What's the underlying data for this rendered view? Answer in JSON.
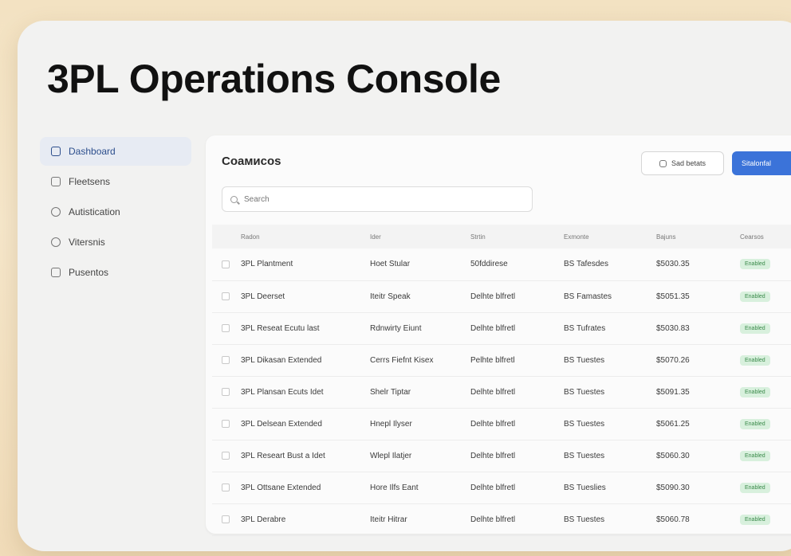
{
  "app": {
    "title": "3PL Operations Console"
  },
  "sidebar": {
    "items": [
      {
        "label": "Dashboard",
        "icon": "dashboard-icon",
        "active": true
      },
      {
        "label": "Fleetsens",
        "icon": "calendar-icon"
      },
      {
        "label": "Autistication",
        "icon": "settings-icon"
      },
      {
        "label": "Vitersnis",
        "icon": "box-icon"
      },
      {
        "label": "Pusentos",
        "icon": "document-icon"
      }
    ]
  },
  "panel": {
    "title": "Coaмисos",
    "secondary_button": "Sad betats",
    "primary_button": "Sitalonfal",
    "search_placeholder": "Search"
  },
  "table": {
    "headers": [
      "Radon",
      "Ider",
      "Strtin",
      "Exmonte",
      "Bajuns",
      "Cearsos"
    ],
    "rows": [
      [
        "3PL Plantment",
        "Hoet Stular",
        "50fddirese",
        "BS Tafesdes",
        "$5030.35",
        "Enabled"
      ],
      [
        "3PL Deerset",
        "Iteitr Speak",
        "Delhte blfretl",
        "BS Famastes",
        "$5051.35",
        "Enabled"
      ],
      [
        "3PL Reseat Ecutu last",
        "Rdnwirty Eiunt",
        "Delhte blfretl",
        "BS Tufrates",
        "$5030.83",
        "Enabled"
      ],
      [
        "3PL Dikasan Extended",
        "Cerrs Fiefnt Kisex",
        "Pelhte blfretl",
        "BS Tuestes",
        "$5070.26",
        "Enabled"
      ],
      [
        "3PL Plansan Ecuts Idet",
        "Shelr Tiptar",
        "Delhte blfretl",
        "BS Tuestes",
        "$5091.35",
        "Enabled"
      ],
      [
        "3PL Delsean Extended",
        "Hnepl Ilyser",
        "Delhte blfretl",
        "BS Tuestes",
        "$5061.25",
        "Enabled"
      ],
      [
        "3PL Researt Bust a Idet",
        "Wlepl Ilatjer",
        "Delhte blfretl",
        "BS Tuestes",
        "$5060.30",
        "Enabled"
      ],
      [
        "3PL Ottsane Extended",
        "Hore Ilfs Eant",
        "Delhte blfretl",
        "BS Tueslies",
        "$5090.30",
        "Enabled"
      ],
      [
        "3PL Derabre",
        "Iteitr Hitrar",
        "Delhte blfretl",
        "BS Tuestes",
        "$5060.78",
        "Enabled"
      ]
    ]
  },
  "colors": {
    "accent": "#3b73d9",
    "badge_bg": "#d8f0dd",
    "badge_fg": "#3a8a4a"
  }
}
